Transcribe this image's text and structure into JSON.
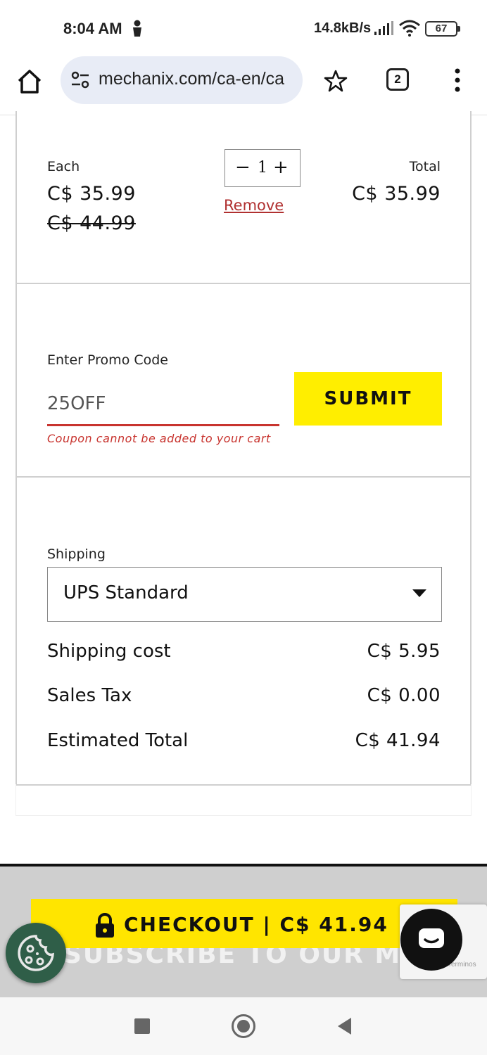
{
  "status_bar": {
    "time": "8:04 AM",
    "network_speed": "14.8kB/s",
    "battery": "67"
  },
  "browser": {
    "url": "mechanix.com/ca-en/ca",
    "tab_count": "2"
  },
  "cart_item": {
    "each_label": "Each",
    "each_price": "C$ 35.99",
    "original_price": "C$ 44.99",
    "quantity": "1",
    "remove_label": "Remove",
    "total_label": "Total",
    "total_price": "C$ 35.99"
  },
  "promo": {
    "label": "Enter Promo Code",
    "value": "25OFF",
    "error": "Coupon cannot be added to your cart",
    "submit_label": "SUBMIT"
  },
  "shipping": {
    "label": "Shipping",
    "selected": "UPS Standard",
    "rows": [
      {
        "label": "Shipping cost",
        "value": "C$ 5.95"
      },
      {
        "label": "Sales Tax",
        "value": "C$ 0.00"
      },
      {
        "label": "Estimated Total",
        "value": "C$ 41.94"
      }
    ]
  },
  "checkout": {
    "label": "CHECKOUT | C$ 41.94",
    "subscribe_text": "SUBSCRIBE TO OUR MAILIN",
    "recaptcha_text": "Terminos"
  },
  "colors": {
    "accent_yellow": "#ffee00",
    "error_red": "#c8342f",
    "cookie_green": "#2f5e48"
  }
}
